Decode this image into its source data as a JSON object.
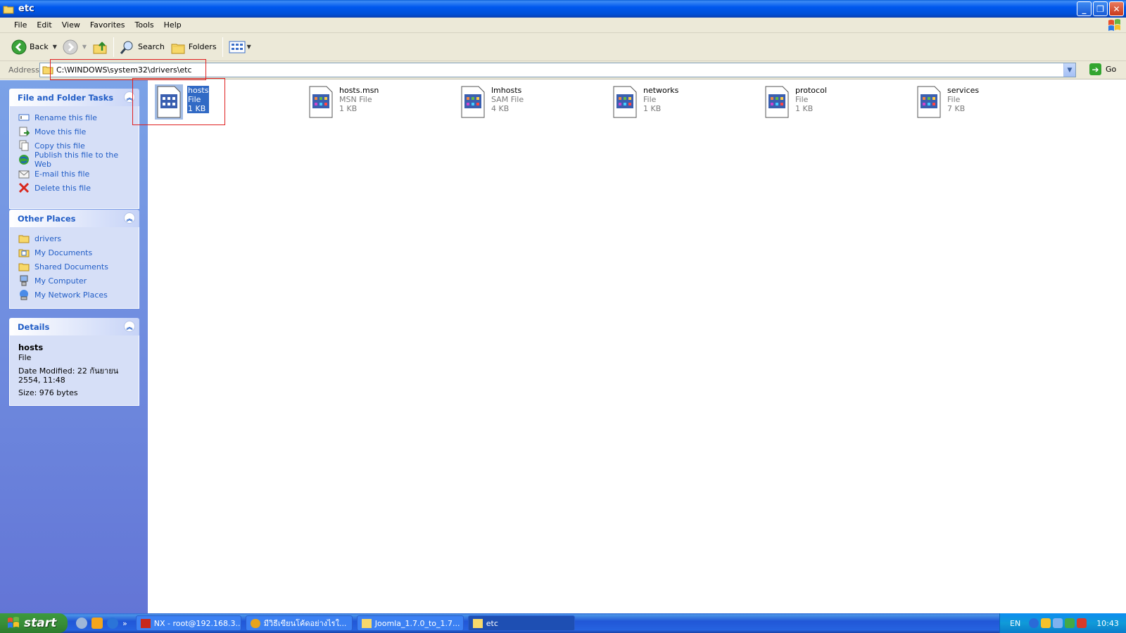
{
  "window": {
    "title": "etc"
  },
  "menu": [
    "File",
    "Edit",
    "View",
    "Favorites",
    "Tools",
    "Help"
  ],
  "toolbar": {
    "back": "Back",
    "search": "Search",
    "folders": "Folders"
  },
  "address": {
    "label": "Address",
    "value": "C:\\WINDOWS\\system32\\drivers\\etc",
    "go": "Go"
  },
  "left": {
    "file_tasks": {
      "title": "File and Folder Tasks",
      "items": [
        "Rename this file",
        "Move this file",
        "Copy this file",
        "Publish this file to the Web",
        "E-mail this file",
        "Delete this file"
      ]
    },
    "other_places": {
      "title": "Other Places",
      "items": [
        "drivers",
        "My Documents",
        "Shared Documents",
        "My Computer",
        "My Network Places"
      ]
    },
    "details": {
      "title": "Details",
      "name": "hosts",
      "type": "File",
      "modified": "Date Modified: 22 กันยายน 2554, 11:48",
      "size": "Size: 976 bytes"
    }
  },
  "files": [
    {
      "name": "hosts",
      "type": "File",
      "size": "1 KB"
    },
    {
      "name": "hosts.msn",
      "type": "MSN File",
      "size": "1 KB"
    },
    {
      "name": "lmhosts",
      "type": "SAM File",
      "size": "4 KB"
    },
    {
      "name": "networks",
      "type": "File",
      "size": "1 KB"
    },
    {
      "name": "protocol",
      "type": "File",
      "size": "1 KB"
    },
    {
      "name": "services",
      "type": "File",
      "size": "7 KB"
    }
  ],
  "taskbar": {
    "start": "start",
    "buttons": [
      "NX - root@192.168.3....",
      "มีวิธีเขียนโค้ดอย่างไรใ...",
      "Joomla_1.7.0_to_1.7...",
      "etc"
    ],
    "lang": "EN",
    "clock": "10:43",
    "more": "»"
  }
}
